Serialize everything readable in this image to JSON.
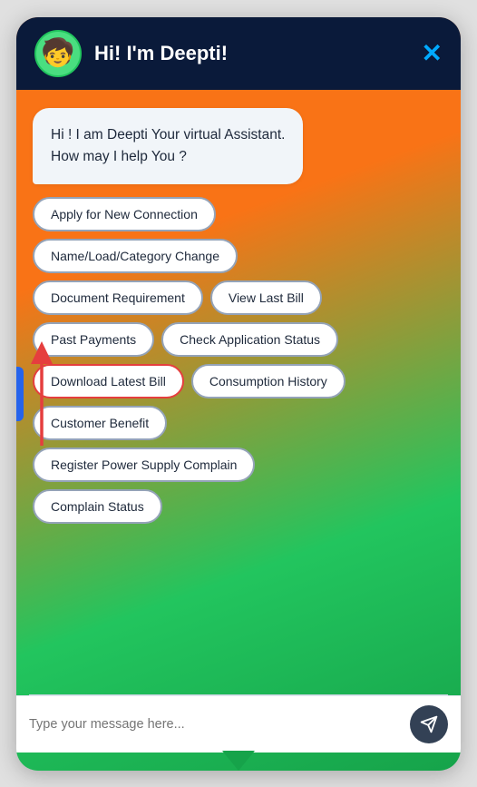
{
  "header": {
    "title": "Hi! I'm Deepti!",
    "close_label": "✕",
    "avatar_emoji": "🧒"
  },
  "greeting": {
    "line1": "Hi ! I am Deepti Your virtual Assistant.",
    "line2": "How may I help You ?"
  },
  "buttons": [
    {
      "id": "apply-new-connection",
      "label": "Apply for New Connection",
      "row": 0,
      "highlighted": false
    },
    {
      "id": "name-load-category",
      "label": "Name/Load/Category Change",
      "row": 1,
      "highlighted": false
    },
    {
      "id": "document-requirement",
      "label": "Document Requirement",
      "row": 2,
      "highlighted": false
    },
    {
      "id": "view-last-bill",
      "label": "View Last Bill",
      "row": 2,
      "highlighted": false
    },
    {
      "id": "past-payments",
      "label": "Past Payments",
      "row": 3,
      "highlighted": false
    },
    {
      "id": "check-application-status",
      "label": "Check Application Status",
      "row": 3,
      "highlighted": false
    },
    {
      "id": "download-latest-bill",
      "label": "Download Latest Bill",
      "row": 4,
      "highlighted": true
    },
    {
      "id": "consumption-history",
      "label": "Consumption History",
      "row": 4,
      "highlighted": false
    },
    {
      "id": "customer-benefit",
      "label": "Customer Benefit",
      "row": 5,
      "highlighted": false
    },
    {
      "id": "register-supply-complain",
      "label": "Register Power Supply Complain",
      "row": 6,
      "highlighted": false
    },
    {
      "id": "complain-status",
      "label": "Complain Status",
      "row": 7,
      "highlighted": false
    }
  ],
  "input": {
    "placeholder": "Type your message here..."
  }
}
